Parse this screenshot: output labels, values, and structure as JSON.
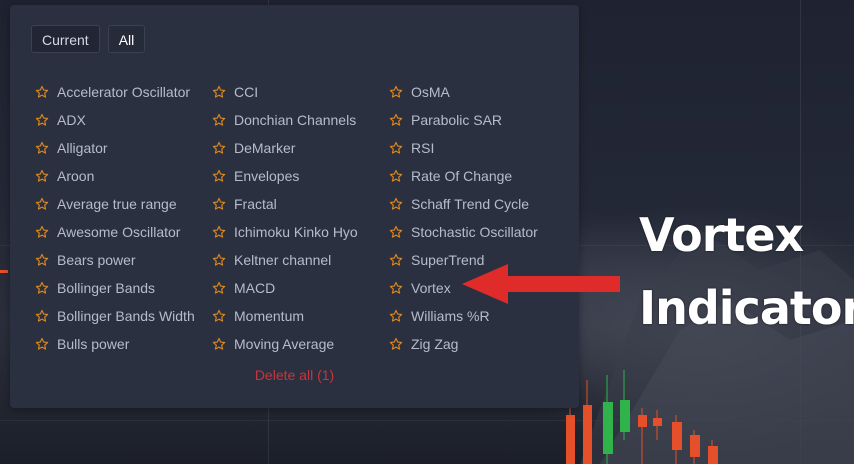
{
  "tabs": [
    {
      "label": "Current",
      "active": true
    },
    {
      "label": "All",
      "active": false
    }
  ],
  "columns": [
    [
      "Accelerator Oscillator",
      "ADX",
      "Alligator",
      "Aroon",
      "Average true range",
      "Awesome Oscillator",
      "Bears power",
      "Bollinger Bands",
      "Bollinger Bands Width",
      "Bulls power"
    ],
    [
      "CCI",
      "Donchian Channels",
      "DeMarker",
      "Envelopes",
      "Fractal",
      "Ichimoku Kinko Hyo",
      "Keltner channel",
      "MACD",
      "Momentum",
      "Moving Average"
    ],
    [
      "OsMA",
      "Parabolic SAR",
      "RSI",
      "Rate Of Change",
      "Schaff Trend Cycle",
      "Stochastic Oscillator",
      "SuperTrend",
      "Vortex",
      "Williams %R",
      "Zig Zag"
    ]
  ],
  "delete_all_label": "Delete all (1)",
  "annotation": {
    "line1": "Vortex",
    "line2": "Indicator"
  },
  "colors": {
    "star": "#d9861f",
    "arrow": "#e02b2b",
    "delete": "#c8343a",
    "candle_up": "#2fb34a",
    "candle_down": "#e5502a"
  }
}
